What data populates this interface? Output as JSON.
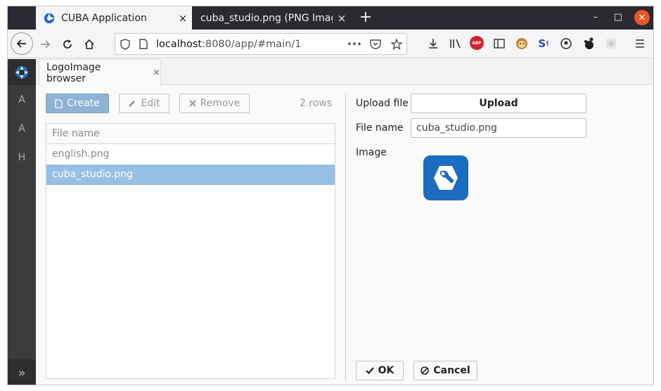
{
  "browser": {
    "tabs": [
      {
        "label": "CUBA Application",
        "close": "×"
      },
      {
        "label": "cuba_studio.png (PNG Imag",
        "close": "×"
      }
    ],
    "new_tab": "+",
    "window": {
      "minimize": "–",
      "maximize": "□",
      "close": "×"
    },
    "url": {
      "host": "localhost",
      "rest": ":8080/app/#main/1"
    },
    "url_more": "•••",
    "abp_label": "ABP"
  },
  "app": {
    "sidebar": {
      "items": [
        "A",
        "A",
        "H"
      ],
      "collapse": "»"
    },
    "tab": {
      "label": "LogoImage browser",
      "close": "×"
    },
    "toolbar": {
      "create": "Create",
      "edit": "Edit",
      "remove": "Remove",
      "rows": "2 rows"
    },
    "table": {
      "header": "File name",
      "rows": [
        "english.png",
        "cuba_studio.png"
      ],
      "selected_index": 1
    },
    "form": {
      "upload_label": "Upload file",
      "upload_button": "Upload",
      "filename_label": "File name",
      "filename_value": "cuba_studio.png",
      "image_label": "Image"
    },
    "actions": {
      "ok": "OK",
      "cancel": "Cancel"
    },
    "colors": {
      "accent": "#98c0e6",
      "sidebar": "#3c3c3c",
      "logo": "#1a6dc0",
      "close": "#e95420"
    }
  }
}
